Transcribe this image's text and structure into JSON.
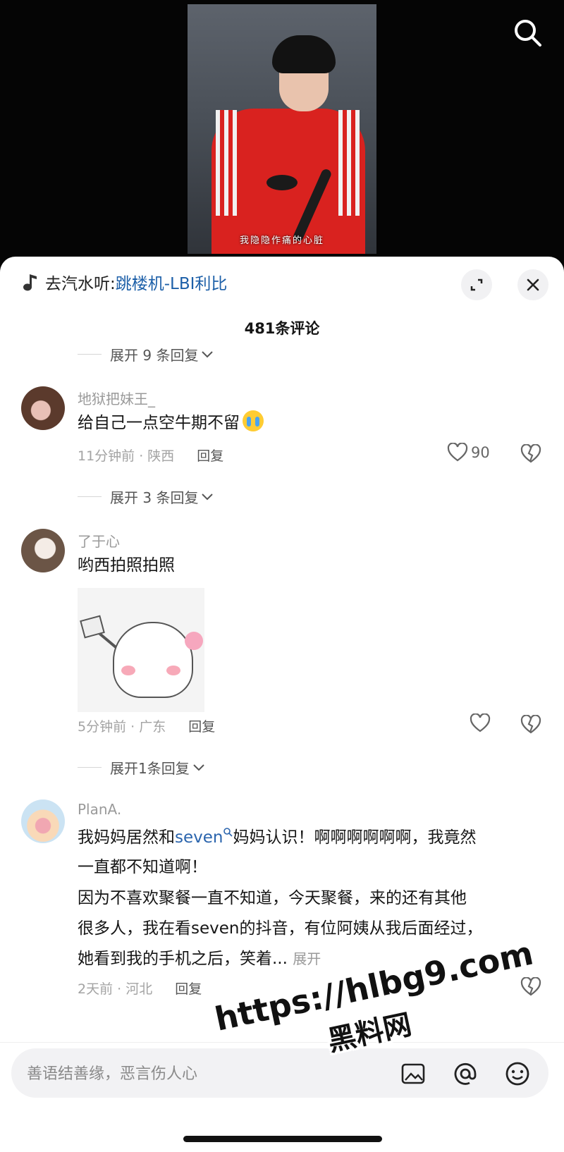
{
  "video": {
    "subtitle": "我隐隐作痛的心脏",
    "search_icon": "search-icon"
  },
  "music": {
    "prefix": "去汽水听:",
    "song": "跳楼机-LBI利比",
    "note_icon": "music-note-icon"
  },
  "header": {
    "comment_count": "481条评论",
    "expand_icon": "collapse-arrows-icon",
    "close_icon": "close-icon"
  },
  "expand_rows": [
    {
      "label": "展开 9 条回复"
    },
    {
      "label": "展开 3 条回复"
    },
    {
      "label": "展开1条回复"
    }
  ],
  "comments": [
    {
      "username": "地狱把妹王_",
      "text": "给自己一点空牛期不留",
      "time": "11分钟前 · 陕西",
      "reply": "回复",
      "likes": "90"
    },
    {
      "username": "了于心",
      "text": "哟西拍照拍照",
      "time": "5分钟前 · 广东",
      "reply": "回复",
      "likes": ""
    },
    {
      "username": "PlanA.",
      "text_part1": "我妈妈居然和",
      "hashtag": "seven",
      "text_part2": "妈妈认识！啊啊啊啊啊啊，我竟然",
      "line2": "一直都不知道啊！",
      "line3": "因为不喜欢聚餐一直不知道，今天聚餐，来的还有其他",
      "line4": "很多人，我在看seven的抖音，有位阿姨从我后面经过，",
      "line5": "她看到我的手机之后，笑着...",
      "expand": "展开",
      "time": "2天前 · 河北",
      "reply": "回复"
    }
  ],
  "input": {
    "placeholder": "善语结善缘，恶言伤人心"
  },
  "watermark": {
    "url": "https://hlbg9.com",
    "name": "黑料网"
  },
  "colors": {
    "link": "#1c5fa8",
    "text": "#161616",
    "muted": "#9a9a9a"
  }
}
